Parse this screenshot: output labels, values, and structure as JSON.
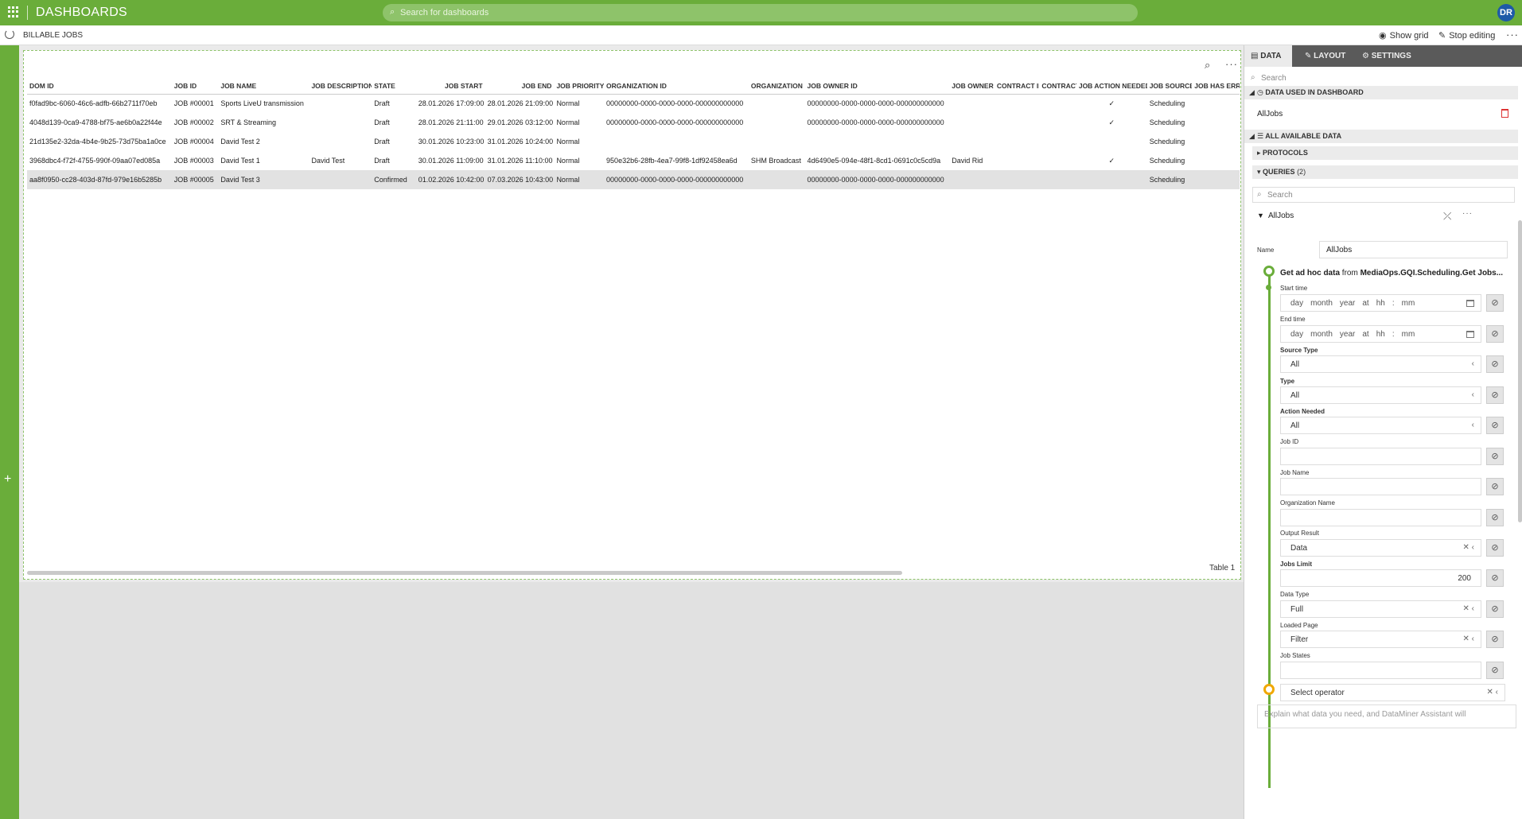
{
  "topbar": {
    "title": "DASHBOARDS",
    "search_placeholder": "Search for dashboards",
    "avatar": "DR",
    "brand_color": "#6aad3a"
  },
  "subbar": {
    "dashboard_name": "BILLABLE JOBS",
    "show_grid": "Show grid",
    "stop_editing": "Stop editing",
    "more": "···"
  },
  "table": {
    "headers": [
      "DOM ID",
      "JOB ID",
      "JOB NAME",
      "JOB DESCRIPTION",
      "STATE",
      "JOB START",
      "JOB END",
      "JOB PRIORITY",
      "ORGANIZATION ID",
      "ORGANIZATION",
      "JOB OWNER ID",
      "JOB OWNER",
      "CONTRACT ID",
      "CONTRACT",
      "JOB ACTION NEEDED",
      "JOB SOURCE",
      "JOB HAS ERRO"
    ],
    "rows": [
      [
        "f0fad9bc-6060-46c6-adfb-66b2711f70eb",
        "JOB #00001",
        "Sports LiveU transmission",
        "",
        "Draft",
        "28.01.2026 17:09:00",
        "28.01.2026 21:09:00",
        "Normal",
        "00000000-0000-0000-0000-000000000000",
        "",
        "00000000-0000-0000-0000-000000000000",
        "",
        "",
        "",
        "✓",
        "Scheduling",
        ""
      ],
      [
        "4048d139-0ca9-4788-bf75-ae6b0a22f44e",
        "JOB #00002",
        "SRT & Streaming",
        "",
        "Draft",
        "28.01.2026 21:11:00",
        "29.01.2026 03:12:00",
        "Normal",
        "00000000-0000-0000-0000-000000000000",
        "",
        "00000000-0000-0000-0000-000000000000",
        "",
        "",
        "",
        "✓",
        "Scheduling",
        ""
      ],
      [
        "21d135e2-32da-4b4e-9b25-73d75ba1a0ce",
        "JOB #00004",
        "David Test 2",
        "",
        "Draft",
        "30.01.2026 10:23:00",
        "31.01.2026 10:24:00",
        "Normal",
        "",
        "",
        "",
        "",
        "",
        "",
        "",
        "Scheduling",
        ""
      ],
      [
        "3968dbc4-f72f-4755-990f-09aa07ed085a",
        "JOB #00003",
        "David Test 1",
        "David Test",
        "Draft",
        "30.01.2026 11:09:00",
        "31.01.2026 11:10:00",
        "Normal",
        "950e32b6-28fb-4ea7-99f8-1df92458ea6d",
        "SHM Broadcast",
        "4d6490e5-094e-48f1-8cd1-0691c0c5cd9a",
        "David Rid",
        "",
        "",
        "✓",
        "Scheduling",
        ""
      ],
      [
        "aa8f0950-cc28-403d-87fd-979e16b5285b",
        "JOB #00005",
        "David Test 3",
        "",
        "Confirmed",
        "01.02.2026 10:42:00",
        "07.03.2026 10:43:00",
        "Normal",
        "00000000-0000-0000-0000-000000000000",
        "",
        "00000000-0000-0000-0000-000000000000",
        "",
        "",
        "",
        "",
        "Scheduling",
        ""
      ]
    ],
    "selected_row": 4,
    "caption": "Table 1"
  },
  "panel": {
    "tabs": [
      "DATA",
      "LAYOUT",
      "SETTINGS"
    ],
    "search_placeholder": "Search",
    "used_header": "DATA USED IN DASHBOARD",
    "used_item": "AllJobs",
    "available_header": "ALL AVAILABLE DATA",
    "protocols": "PROTOCOLS",
    "queries": "QUERIES",
    "queries_count": "(2)",
    "query_search_placeholder": "Search",
    "query_name": "AllJobs",
    "name_label": "Name",
    "name_value": "AllJobs",
    "get_prefix": "Get ad hoc data",
    "get_from": "from",
    "get_source": "MediaOps.GQI.Scheduling.Get Jobs...",
    "date_placeholder": {
      "day": "day",
      "month": "month",
      "year": "year",
      "at": "at",
      "hh": "hh",
      "colon": ":",
      "mm": "mm"
    },
    "fields": {
      "start_time": "Start time",
      "end_time": "End time",
      "source_type": "Source Type",
      "source_type_value": "All",
      "type": "Type",
      "type_value": "All",
      "action_needed": "Action Needed",
      "action_needed_value": "All",
      "job_id": "Job ID",
      "job_name": "Job Name",
      "organization_name": "Organization Name",
      "output_result": "Output Result",
      "output_result_value": "Data",
      "jobs_limit": "Jobs Limit",
      "jobs_limit_value": "200",
      "data_type": "Data Type",
      "data_type_value": "Full",
      "loaded_page": "Loaded Page",
      "loaded_page_value": "Filter",
      "job_states": "Job States"
    },
    "operator_placeholder": "Select operator",
    "assistant_placeholder": "Explain what data you need, and DataMiner Assistant will"
  }
}
